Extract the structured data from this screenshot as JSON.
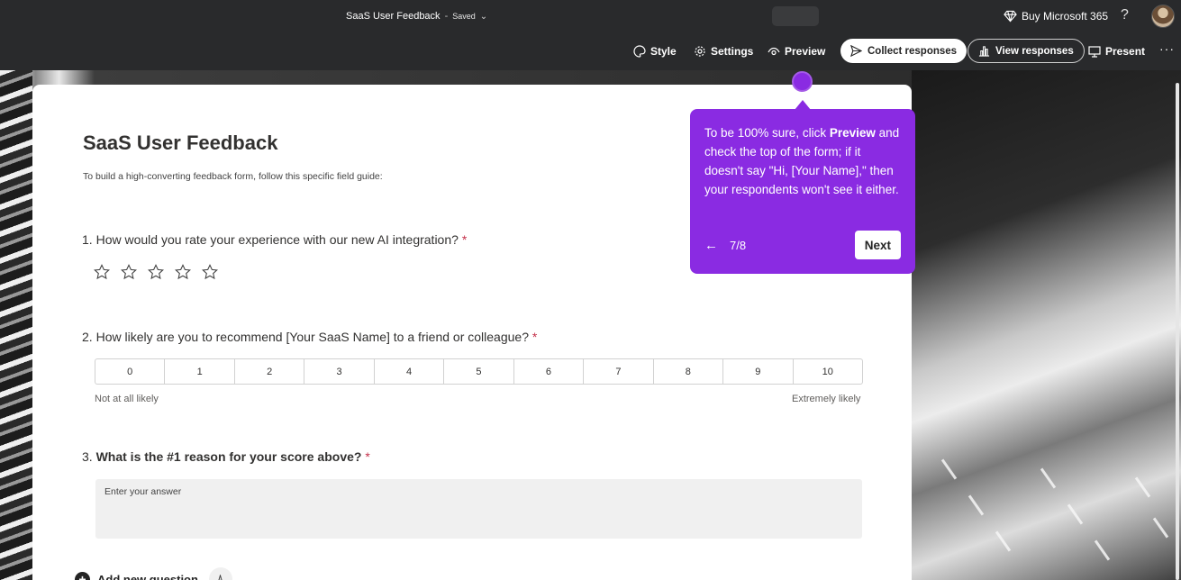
{
  "header": {
    "doc_title": "SaaS User Feedback",
    "separator": "-",
    "status": "Saved",
    "buy_label": "Buy Microsoft 365",
    "help": "?"
  },
  "commands": {
    "style": "Style",
    "settings": "Settings",
    "preview": "Preview",
    "collect": "Collect responses",
    "view": "View responses",
    "present": "Present",
    "more": "···"
  },
  "form": {
    "title": "SaaS User Feedback",
    "description": "To build a high-converting feedback form, follow this specific field guide:",
    "questions": [
      {
        "number": "1.",
        "text": "How would you rate your experience with our new AI integration?",
        "required": "*"
      },
      {
        "number": "2.",
        "text": "How likely are you to recommend [Your SaaS Name] to a friend or colleague?",
        "required": "*"
      },
      {
        "number": "3.",
        "text": "What is the #1 reason for your score above?",
        "required": "*"
      }
    ],
    "rating_max": 5,
    "nps_scale": [
      "0",
      "1",
      "2",
      "3",
      "4",
      "5",
      "6",
      "7",
      "8",
      "9",
      "10"
    ],
    "nps_low_label": "Not at all likely",
    "nps_high_label": "Extremely likely",
    "answer_placeholder": "Enter your answer",
    "add_question": "Add new question"
  },
  "tour": {
    "text_before": "To be 100% sure, click ",
    "text_bold": "Preview",
    "text_after": " and check the top of the form; if it doesn't say \"Hi, [Your Name],\" then your respondents won't see it either.",
    "back": "←",
    "step": "7/8",
    "next": "Next"
  },
  "colors": {
    "accent": "#8a2be2",
    "topbar": "#292a2c",
    "required": "#c4314b"
  }
}
